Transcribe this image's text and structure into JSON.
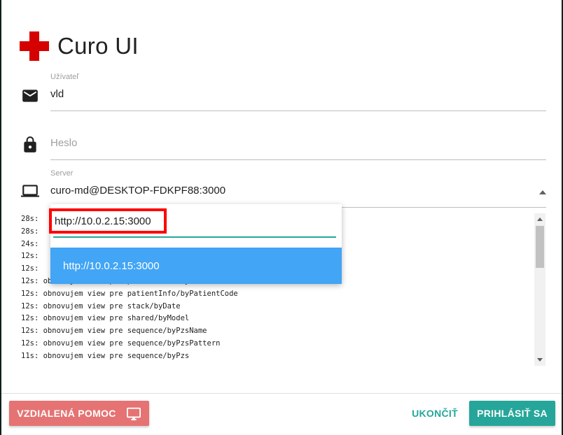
{
  "app": {
    "title": "Curo UI",
    "logo_color": "#d50000"
  },
  "form": {
    "user": {
      "label": "Užívateľ",
      "value": "vld",
      "icon": "mail-icon"
    },
    "password": {
      "placeholder": "Heslo",
      "icon": "lock-icon"
    },
    "server": {
      "label": "Server",
      "value": "curo-md@DESKTOP-FDKPF88:3000",
      "icon": "laptop-icon"
    }
  },
  "dropdown": {
    "input_value": "http://10.0.2.15:3000",
    "options": [
      "http://10.0.2.15:3000"
    ],
    "highlight_color": "#42a5f5"
  },
  "log": {
    "lines": [
      "28s: ",
      "28s: ",
      "24s: ",
      "12s: ",
      "12s: ",
      "12s: obnovujem view pre patientInfo/byLekarAndPatientCode",
      "12s: obnovujem view pre patientInfo/byPatientCode",
      "12s: obnovujem view pre stack/byDate",
      "12s: obnovujem view pre shared/byModel",
      "12s: obnovujem view pre sequence/byPzsName",
      "12s: obnovujem view pre sequence/byPzsPattern",
      "11s: obnovujem view pre sequence/byPzs"
    ]
  },
  "footer": {
    "remote_help_label": "VZDIALENÁ POMOC",
    "remote_help_icon": "monitor-icon",
    "quit_label": "UKONČIŤ",
    "login_label": "PRIHLÁSIŤ SA",
    "accent_color": "#26a69a",
    "remote_color": "#e57373"
  }
}
